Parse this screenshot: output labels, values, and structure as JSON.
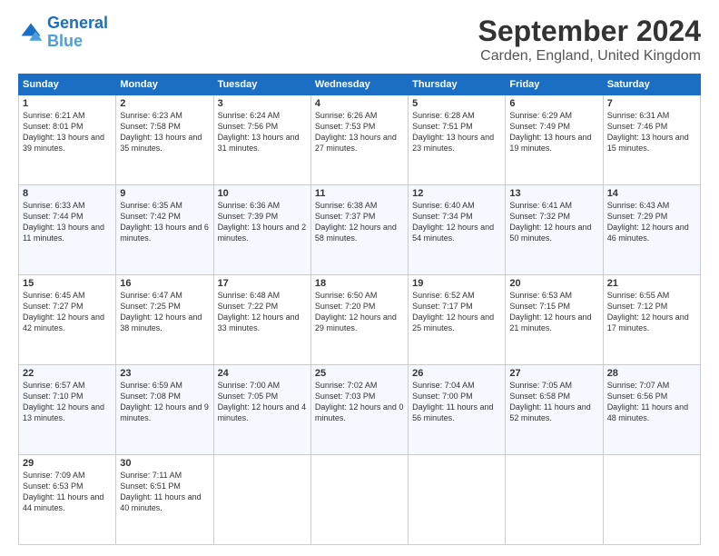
{
  "logo": {
    "line1": "General",
    "line2": "Blue"
  },
  "title": "September 2024",
  "subtitle": "Carden, England, United Kingdom",
  "headers": [
    "Sunday",
    "Monday",
    "Tuesday",
    "Wednesday",
    "Thursday",
    "Friday",
    "Saturday"
  ],
  "weeks": [
    [
      {
        "day": "1",
        "sunrise": "6:21 AM",
        "sunset": "8:01 PM",
        "daylight": "13 hours and 39 minutes."
      },
      {
        "day": "2",
        "sunrise": "6:23 AM",
        "sunset": "7:58 PM",
        "daylight": "13 hours and 35 minutes."
      },
      {
        "day": "3",
        "sunrise": "6:24 AM",
        "sunset": "7:56 PM",
        "daylight": "13 hours and 31 minutes."
      },
      {
        "day": "4",
        "sunrise": "6:26 AM",
        "sunset": "7:53 PM",
        "daylight": "13 hours and 27 minutes."
      },
      {
        "day": "5",
        "sunrise": "6:28 AM",
        "sunset": "7:51 PM",
        "daylight": "13 hours and 23 minutes."
      },
      {
        "day": "6",
        "sunrise": "6:29 AM",
        "sunset": "7:49 PM",
        "daylight": "13 hours and 19 minutes."
      },
      {
        "day": "7",
        "sunrise": "6:31 AM",
        "sunset": "7:46 PM",
        "daylight": "13 hours and 15 minutes."
      }
    ],
    [
      {
        "day": "8",
        "sunrise": "6:33 AM",
        "sunset": "7:44 PM",
        "daylight": "13 hours and 11 minutes."
      },
      {
        "day": "9",
        "sunrise": "6:35 AM",
        "sunset": "7:42 PM",
        "daylight": "13 hours and 6 minutes."
      },
      {
        "day": "10",
        "sunrise": "6:36 AM",
        "sunset": "7:39 PM",
        "daylight": "13 hours and 2 minutes."
      },
      {
        "day": "11",
        "sunrise": "6:38 AM",
        "sunset": "7:37 PM",
        "daylight": "12 hours and 58 minutes."
      },
      {
        "day": "12",
        "sunrise": "6:40 AM",
        "sunset": "7:34 PM",
        "daylight": "12 hours and 54 minutes."
      },
      {
        "day": "13",
        "sunrise": "6:41 AM",
        "sunset": "7:32 PM",
        "daylight": "12 hours and 50 minutes."
      },
      {
        "day": "14",
        "sunrise": "6:43 AM",
        "sunset": "7:29 PM",
        "daylight": "12 hours and 46 minutes."
      }
    ],
    [
      {
        "day": "15",
        "sunrise": "6:45 AM",
        "sunset": "7:27 PM",
        "daylight": "12 hours and 42 minutes."
      },
      {
        "day": "16",
        "sunrise": "6:47 AM",
        "sunset": "7:25 PM",
        "daylight": "12 hours and 38 minutes."
      },
      {
        "day": "17",
        "sunrise": "6:48 AM",
        "sunset": "7:22 PM",
        "daylight": "12 hours and 33 minutes."
      },
      {
        "day": "18",
        "sunrise": "6:50 AM",
        "sunset": "7:20 PM",
        "daylight": "12 hours and 29 minutes."
      },
      {
        "day": "19",
        "sunrise": "6:52 AM",
        "sunset": "7:17 PM",
        "daylight": "12 hours and 25 minutes."
      },
      {
        "day": "20",
        "sunrise": "6:53 AM",
        "sunset": "7:15 PM",
        "daylight": "12 hours and 21 minutes."
      },
      {
        "day": "21",
        "sunrise": "6:55 AM",
        "sunset": "7:12 PM",
        "daylight": "12 hours and 17 minutes."
      }
    ],
    [
      {
        "day": "22",
        "sunrise": "6:57 AM",
        "sunset": "7:10 PM",
        "daylight": "12 hours and 13 minutes."
      },
      {
        "day": "23",
        "sunrise": "6:59 AM",
        "sunset": "7:08 PM",
        "daylight": "12 hours and 9 minutes."
      },
      {
        "day": "24",
        "sunrise": "7:00 AM",
        "sunset": "7:05 PM",
        "daylight": "12 hours and 4 minutes."
      },
      {
        "day": "25",
        "sunrise": "7:02 AM",
        "sunset": "7:03 PM",
        "daylight": "12 hours and 0 minutes."
      },
      {
        "day": "26",
        "sunrise": "7:04 AM",
        "sunset": "7:00 PM",
        "daylight": "11 hours and 56 minutes."
      },
      {
        "day": "27",
        "sunrise": "7:05 AM",
        "sunset": "6:58 PM",
        "daylight": "11 hours and 52 minutes."
      },
      {
        "day": "28",
        "sunrise": "7:07 AM",
        "sunset": "6:56 PM",
        "daylight": "11 hours and 48 minutes."
      }
    ],
    [
      {
        "day": "29",
        "sunrise": "7:09 AM",
        "sunset": "6:53 PM",
        "daylight": "11 hours and 44 minutes."
      },
      {
        "day": "30",
        "sunrise": "7:11 AM",
        "sunset": "6:51 PM",
        "daylight": "11 hours and 40 minutes."
      },
      null,
      null,
      null,
      null,
      null
    ]
  ]
}
